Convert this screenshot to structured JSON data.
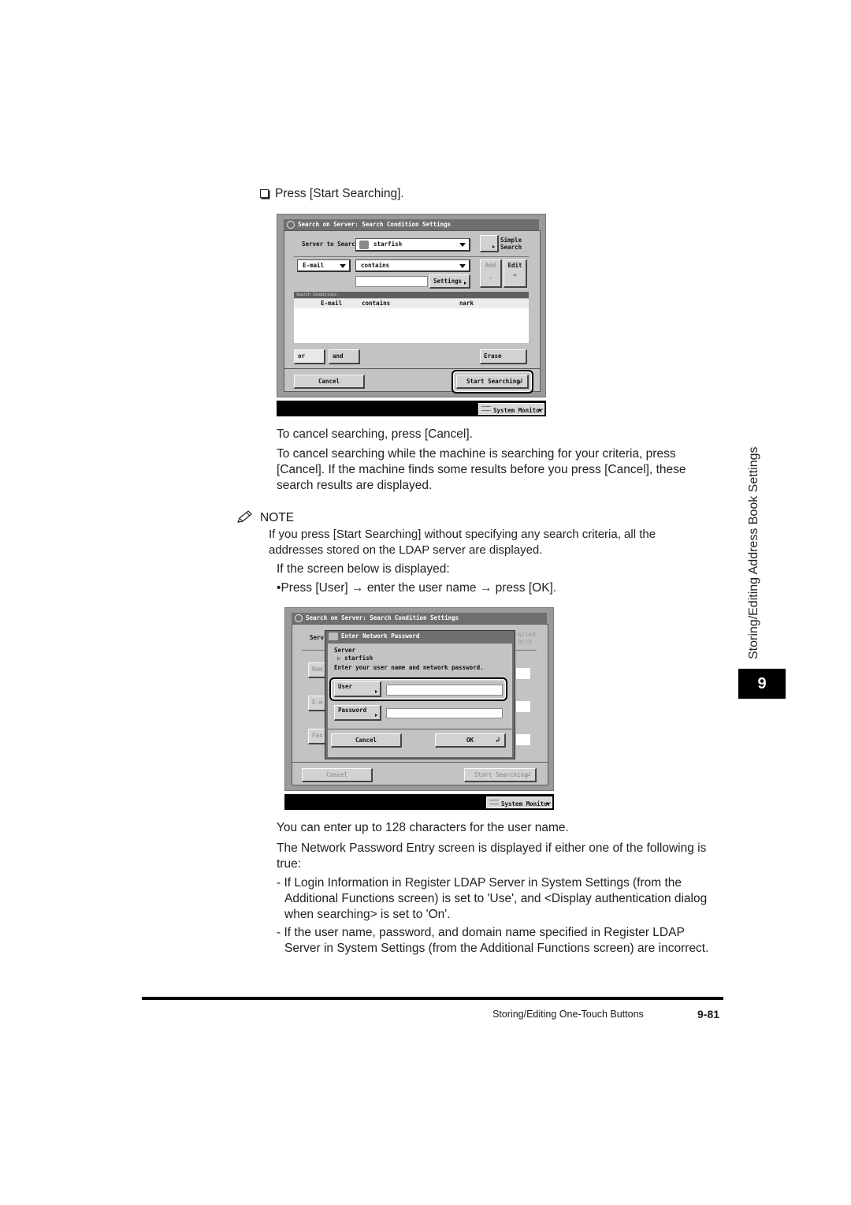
{
  "step": {
    "checkbox_icon": "checkbox-square-icon",
    "text": "Press [Start Searching]."
  },
  "screen1": {
    "title": "Search on Server: Search Condition Settings",
    "server_label": "Server to Search:",
    "server_value": "starfish",
    "simple_search_line1": "Simple",
    "simple_search_line2": "Search",
    "attribute_value": "E-mail",
    "condition_value": "contains",
    "keyword_value": "",
    "settings_label": "Settings",
    "add_label": "Add",
    "edit_label": "Edit",
    "conditions_header": "Search Conditions",
    "conditions": [
      {
        "attribute": "E-mail",
        "condition": "contains",
        "value": "nark"
      }
    ],
    "or_label": "or",
    "and_label": "and",
    "erase_label": "Erase",
    "cancel_label": "Cancel",
    "start_label": "Start Searching",
    "system_monitor_label": "System Monitor"
  },
  "paragraphs1": [
    "To cancel searching, press [Cancel].",
    "To cancel searching while the machine is searching for your criteria, press [Cancel]. If the machine finds some results before you press [Cancel], these search results are displayed."
  ],
  "note": {
    "icon": "pencil-icon",
    "heading": "NOTE",
    "text": "If you press [Start Searching] without specifying any search criteria, all the addresses stored on the LDAP server are displayed.",
    "sub": "If the screen below is displayed:",
    "bullet": "Press [User] → enter the user name → press [OK]."
  },
  "screen2": {
    "title": "Search on Server: Search Condition Settings",
    "bg_server_label": "Serv",
    "bg_detailed_line1": "ailed",
    "bg_detailed_line2": "arch",
    "bg_name": "Nam",
    "bg_email": "E-m",
    "bg_fax": "Fax",
    "bg_cancel": "Cancel",
    "bg_start": "Start Searching",
    "dialog_title": "Enter Network Password",
    "server_heading": "Server",
    "server_value": "▷ starfish",
    "instruction": "Enter your user name and network password.",
    "user_label": "User",
    "user_value": "",
    "password_label": "Password",
    "password_value": "",
    "cancel_label": "Cancel",
    "ok_label": "OK",
    "system_monitor_label": "System Monitor"
  },
  "paragraphs2": [
    "You can enter up to 128 characters for the user name.",
    "The Network Password Entry screen is displayed if either one of the following is true:"
  ],
  "conditions_list": [
    "If Login Information in Register LDAP Server in System Settings (from the Additional Functions screen) is set to 'Use', and <Display authentication dialog when searching> is set to 'On'.",
    "If the user name, password, and domain name specified in Register LDAP Server in System Settings (from the Additional Functions screen) are incorrect."
  ],
  "side": {
    "chapter_title": "Storing/Editing Address Book Settings",
    "chapter_number": "9"
  },
  "footer": {
    "section": "Storing/Editing One-Touch Buttons",
    "page": "9-81"
  }
}
